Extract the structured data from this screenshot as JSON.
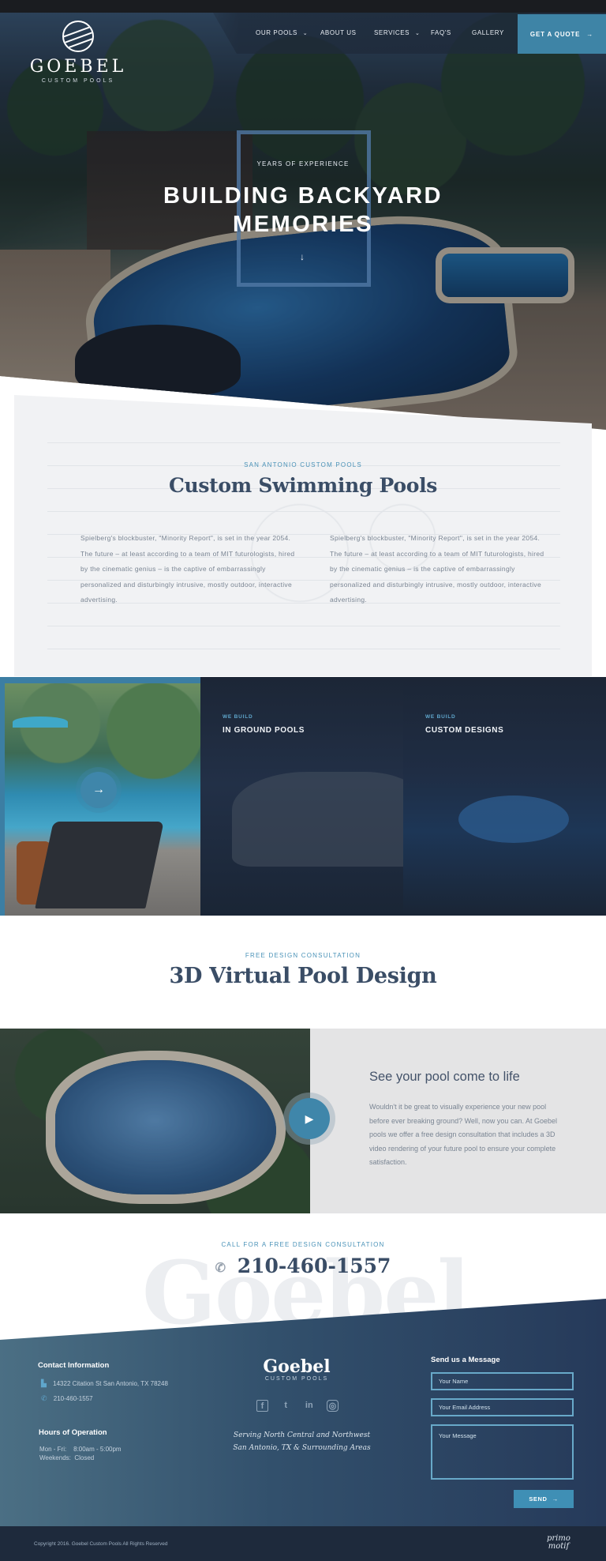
{
  "brand": {
    "name": "GOEBEL",
    "tagline": "CUSTOM POOLS",
    "accent": "#3e84a6",
    "navy": "#3a4d66"
  },
  "nav": {
    "items": [
      {
        "label": "OUR POOLS",
        "has_dropdown": true
      },
      {
        "label": "ABOUT US",
        "has_dropdown": false
      },
      {
        "label": "SERVICES",
        "has_dropdown": true
      },
      {
        "label": "FAQ'S",
        "has_dropdown": false
      },
      {
        "label": "GALLERY",
        "has_dropdown": false
      }
    ],
    "cta_label": "GET A QUOTE",
    "chevron_icon": "chevron-down-icon",
    "arrow_icon": "arrow-right-icon"
  },
  "hero": {
    "kicker": "YEARS OF EXPERIENCE",
    "title_line1": "BUILDING BACKYARD",
    "title_line2": "MEMORIES",
    "scroll_icon": "arrow-down-icon"
  },
  "intro": {
    "kicker": "SAN ANTONIO CUSTOM POOLS",
    "title": "Custom Swimming Pools",
    "paragraph_left": "Spielberg's blockbuster, \"Minority Report\", is set in the year 2054. The future – at least according to a team of MIT futurologists, hired by the cinematic genius – is the captive of embarrassingly personalized and disturbingly intrusive, mostly outdoor, interactive advertising.",
    "paragraph_right": "Spielberg's blockbuster, \"Minority Report\", is set in the year 2054. The future – at least according to a team of MIT futurologists, hired by the cinematic genius – is the captive of embarrassingly personalized and disturbingly intrusive, mostly outdoor, interactive advertising."
  },
  "services": [
    {
      "kicker": "WE BUILD",
      "title": "IN GROUND POOLS"
    },
    {
      "kicker": "WE BUILD",
      "title": "CUSTOM DESIGNS"
    }
  ],
  "virtual": {
    "kicker": "FREE DESIGN CONSULTATION",
    "title": "3D Virtual Pool Design",
    "heading": "See your pool come to life",
    "text": "Wouldn't it be great to visually experience your new pool before ever breaking ground? Well, now you can. At Goebel pools we offer a free design consultation that includes a 3D video rendering of your future pool to ensure your complete satisfaction.",
    "play_icon": "play-icon"
  },
  "call": {
    "kicker": "CALL FOR A FREE DESIGN CONSULTATION",
    "phone": "210-460-1557",
    "watermark": "Goebel"
  },
  "footer": {
    "contact_heading": "Contact Information",
    "address": "14322 Citation St San Antonio, TX 78248",
    "phone": "210-460-1557",
    "hours_heading": "Hours of Operation",
    "hours_line1": "Mon - Fri:    8:00am - 5:00pm",
    "hours_line2": "Weekends:  Closed",
    "logo": "Goebel",
    "logo_sub": "CUSTOM POOLS",
    "social": [
      "facebook-icon",
      "twitter-icon",
      "linkedin-icon",
      "instagram-icon"
    ],
    "serving_line1": "Serving North Central and Northwest",
    "serving_line2": "San Antonio, TX & Surrounding Areas",
    "form_heading": "Send us a Message",
    "name_placeholder": "Your Name",
    "email_placeholder": "Your Email Address",
    "message_placeholder": "Your Message",
    "send_label": "SEND",
    "copyright": "Copyright 2016. Goebel Custom Pools All Rights Reserved",
    "credit_line1": "primo",
    "credit_line2": "motif"
  }
}
